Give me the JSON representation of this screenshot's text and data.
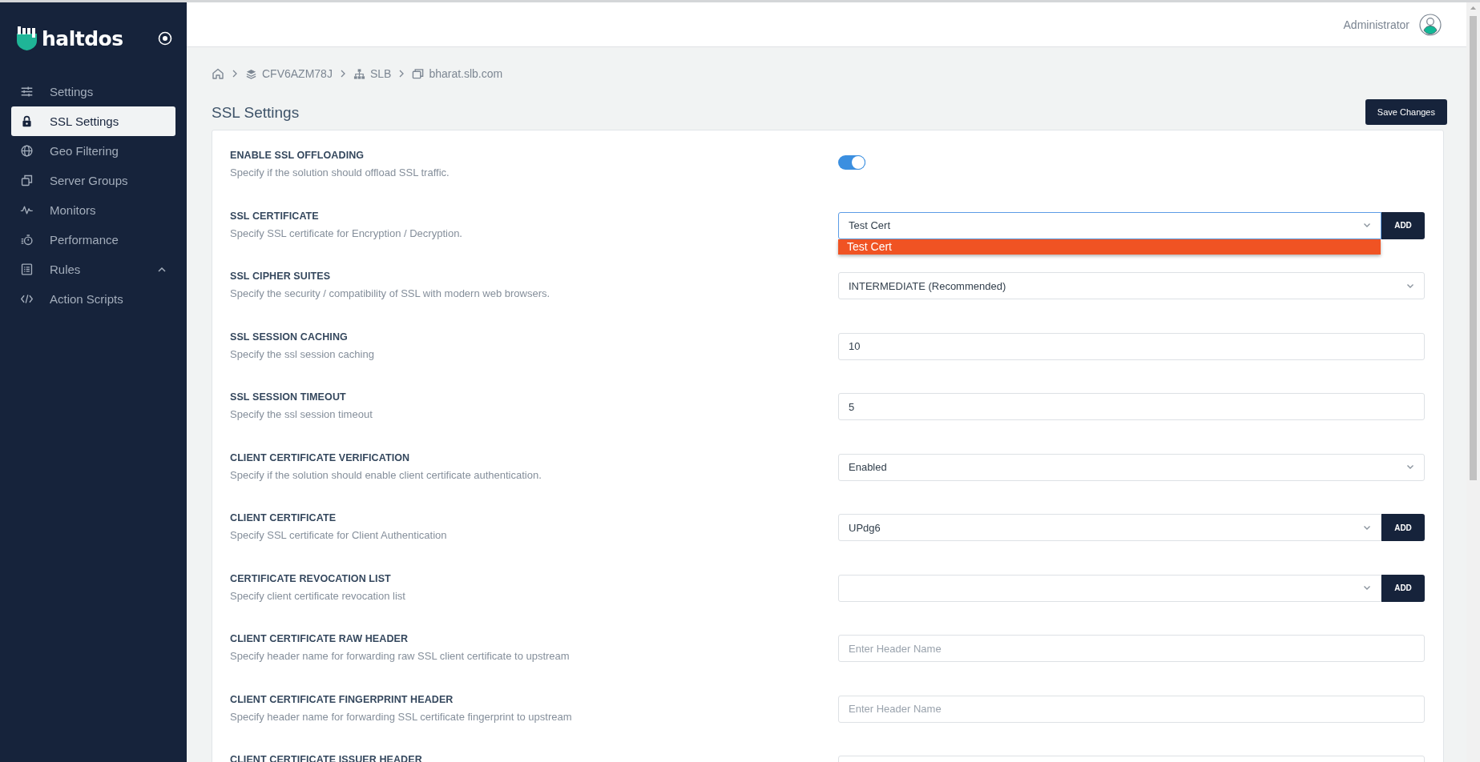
{
  "sidebar": {
    "logo": "haltdos",
    "items": [
      {
        "label": "Settings",
        "selected": false
      },
      {
        "label": "SSL Settings",
        "selected": true
      },
      {
        "label": "Geo Filtering",
        "selected": false
      },
      {
        "label": "Server Groups",
        "selected": false
      },
      {
        "label": "Monitors",
        "selected": false
      },
      {
        "label": "Performance",
        "selected": false
      },
      {
        "label": "Rules",
        "selected": false,
        "expanded": true
      },
      {
        "label": "Action Scripts",
        "selected": false
      }
    ]
  },
  "topbar": {
    "user": "Administrator"
  },
  "breadcrumb": [
    "CFV6AZM78J",
    "SLB",
    "bharat.slb.com"
  ],
  "page": {
    "title": "SSL Settings",
    "save_button": "Save Changes"
  },
  "settings": [
    {
      "kind": "toggle",
      "label": "ENABLE SSL OFFLOADING",
      "description": "Specify if the solution should offload SSL traffic.",
      "on": true
    },
    {
      "kind": "select",
      "label": "SSL CERTIFICATE",
      "description": "Specify SSL certificate for Encryption / Decryption.",
      "value": "Test Cert",
      "add_button": "ADD",
      "open": true,
      "options": [
        {
          "label": "Test Cert",
          "selected": true
        }
      ]
    },
    {
      "kind": "select",
      "label": "SSL CIPHER SUITES",
      "description": "Specify the security / compatibility of SSL with modern web browsers.",
      "value": "INTERMEDIATE (Recommended)",
      "open": false
    },
    {
      "kind": "input",
      "label": "SSL SESSION CACHING",
      "description": "Specify the ssl session caching",
      "value": "10"
    },
    {
      "kind": "input",
      "label": "SSL SESSION TIMEOUT",
      "description": "Specify the ssl session timeout",
      "value": "5"
    },
    {
      "kind": "select",
      "label": "CLIENT CERTIFICATE VERIFICATION",
      "description": "Specify if the solution should enable client certificate authentication.",
      "value": "Enabled",
      "open": false
    },
    {
      "kind": "select",
      "label": "CLIENT CERTIFICATE",
      "description": "Specify SSL certificate for Client Authentication",
      "value": "UPdg6",
      "add_button": "ADD",
      "open": false
    },
    {
      "kind": "select",
      "label": "CERTIFICATE REVOCATION LIST",
      "description": "Specify client certificate revocation list",
      "add_button": "ADD",
      "open": false
    },
    {
      "kind": "input",
      "label": "CLIENT CERTIFICATE RAW HEADER",
      "description": "Specify header name for forwarding raw SSL client certificate to upstream",
      "placeholder": "Enter Header Name"
    },
    {
      "kind": "input",
      "label": "CLIENT CERTIFICATE FINGERPRINT HEADER",
      "description": "Specify header name for forwarding SSL certificate fingerprint to upstream",
      "placeholder": "Enter Header Name"
    },
    {
      "kind": "input",
      "label": "CLIENT CERTIFICATE ISSUER HEADER"
    }
  ]
}
